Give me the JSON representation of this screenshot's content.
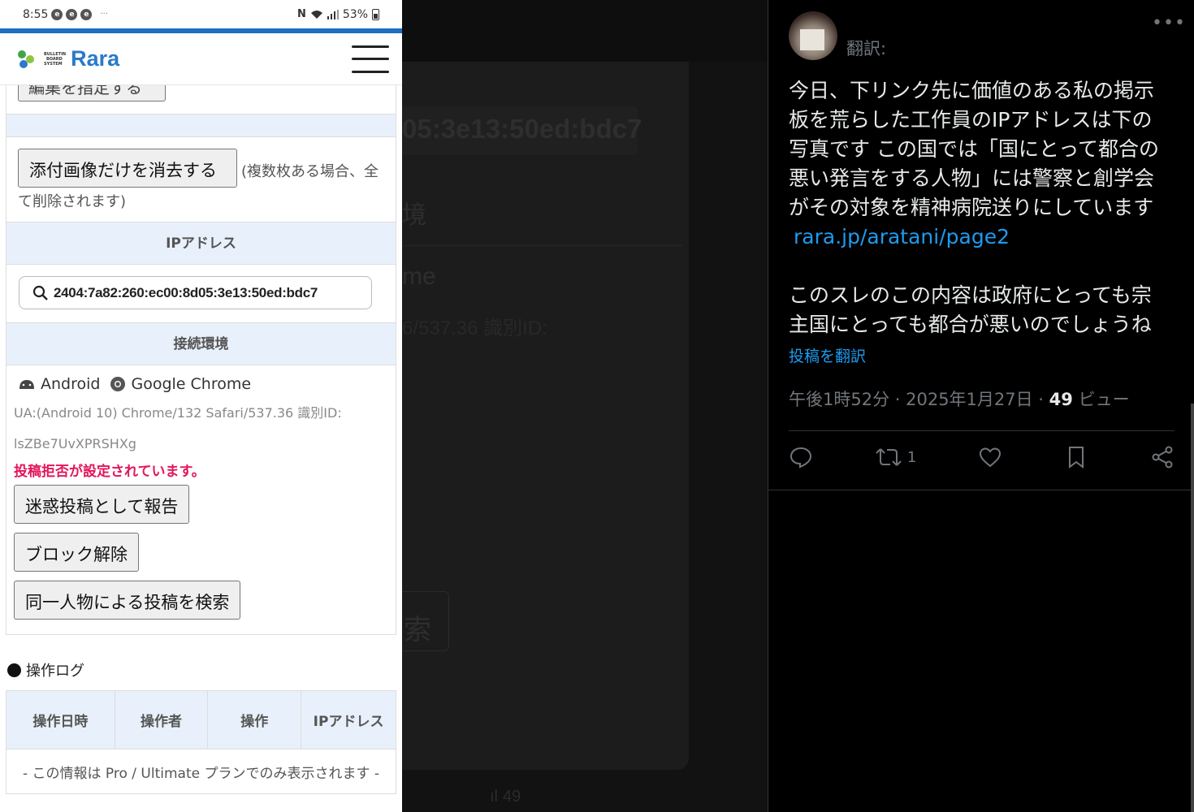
{
  "status_bar": {
    "time": "8:55",
    "battery": "53%"
  },
  "app": {
    "logo_tagline": [
      "BULLETIN",
      "BOARD",
      "SYSTEM"
    ],
    "logo_text": "Rara",
    "colors": {
      "accent": "#1e6fbf",
      "warning": "#e3165b",
      "section_bg": "#e8f1fb"
    }
  },
  "left": {
    "top_cut_button": "編集を指定する",
    "delete_images_button": "添付画像だけを消去する",
    "delete_images_note": "(複数枚ある場合、全て削除されます)",
    "ip_section_title": "IPアドレス",
    "ip_value": "2404:7a82:260:ec00:8d05:3e13:50ed:bdc7",
    "env_section_title": "接続環境",
    "os": "Android",
    "browser": "Google Chrome",
    "ua_line1": "UA:(Android 10) Chrome/132 Safari/537.36 識別ID:",
    "ua_line2": "lsZBe7UvXPRSHXg",
    "blocked_warning": "投稿拒否が設定されています。",
    "report_button": "迷惑投稿として報告",
    "unblock_button": "ブロック解除",
    "search_same_button": "同一人物による投稿を検索",
    "log_title": "操作ログ",
    "log_headers": [
      "操作日時",
      "操作者",
      "操作",
      "IPアドレス"
    ],
    "log_notice": "- この情報は Pro / Ultimate プランでのみ表示されます -"
  },
  "middle": {
    "ip_fragment": "05:3e13:50ed:bdc7",
    "env_fragment": "境",
    "browser_fragment": "me",
    "ua_fragment": "6/537.36 識別ID:",
    "search_fragment": "索",
    "views_fragment": "49"
  },
  "tweet": {
    "translated_label": "翻訳:",
    "body_lines": [
      "今日、下リンク先に価値のある私の掲示",
      "板を荒らした工作員のIPアドレスは下の",
      "写真です この国では「国にとって都合の",
      "悪い発言をする人物」には警察と創学会",
      "がその対象を精神病院送りにしています"
    ],
    "link": "rara.jp/aratani/page2",
    "body_lines_2": [
      "このスレのこの内容は政府にとっても宗",
      "主国にとっても都合が悪いのでしょうね"
    ],
    "translate_link": "投稿を翻訳",
    "timestamp": "午後1時52分 · 2025年1月27日 · ",
    "views_count": "49",
    "views_label": " ビュー",
    "retweet_count": "1",
    "actions": [
      "reply-icon",
      "retweet-icon",
      "like-icon",
      "bookmark-icon",
      "share-icon"
    ]
  }
}
